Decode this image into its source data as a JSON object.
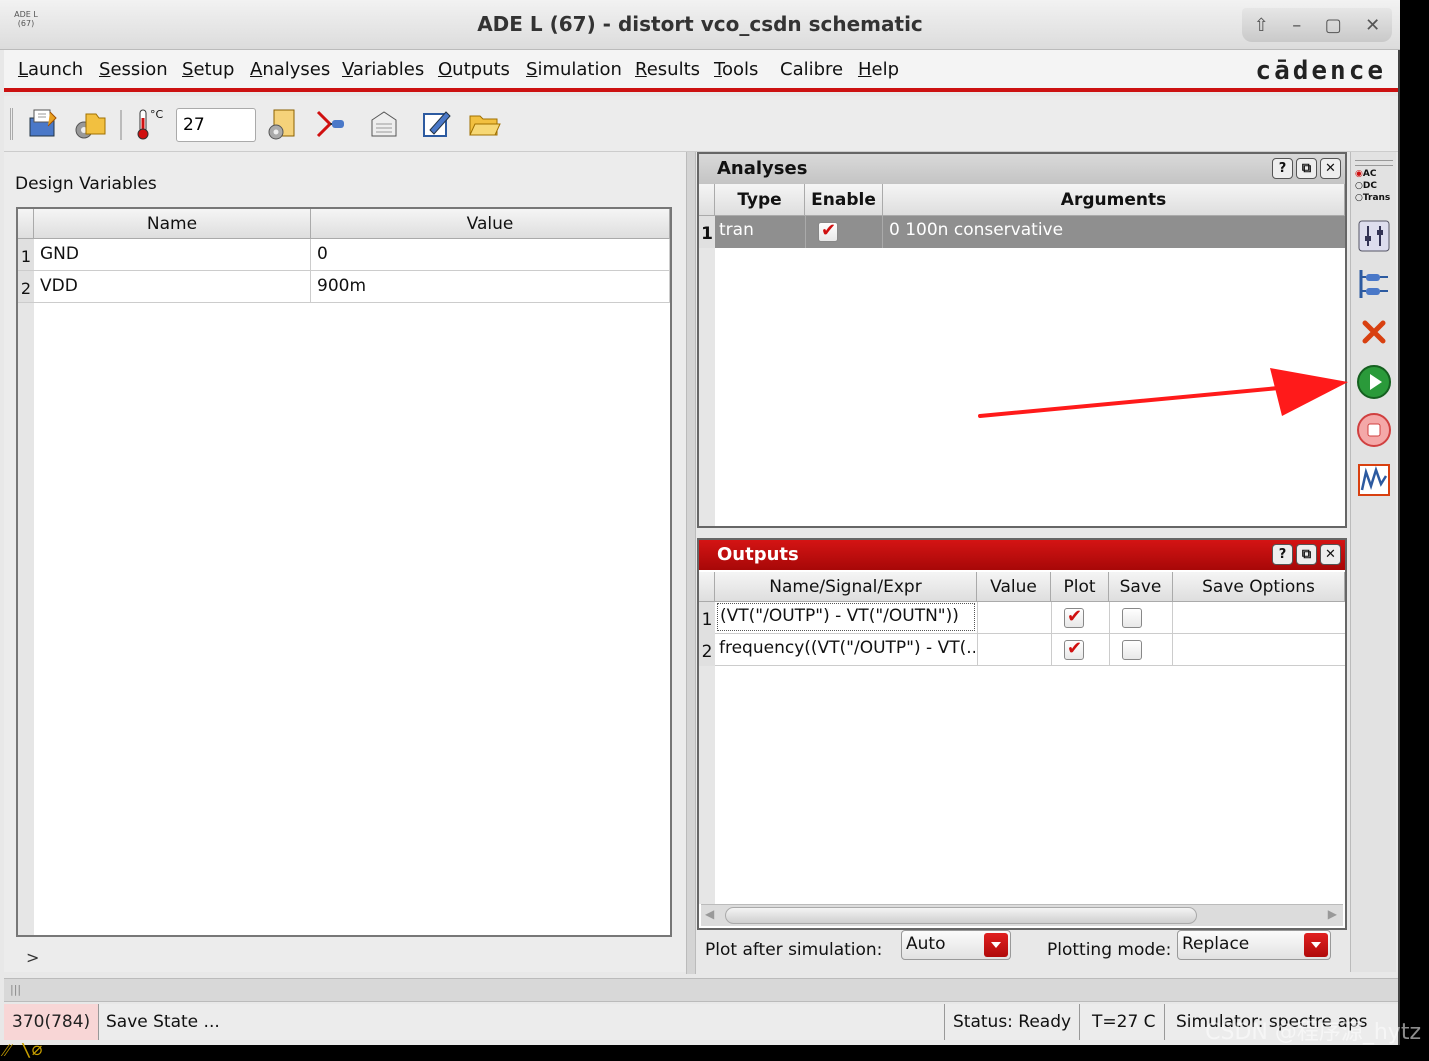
{
  "window": {
    "title": "ADE L (67) - distort vco_csdn schematic",
    "app_icon_text": "ADE L (67)"
  },
  "menu": [
    {
      "label": "Launch",
      "u": "L"
    },
    {
      "label": "Session",
      "u": "S"
    },
    {
      "label": "Setup",
      "u": "S"
    },
    {
      "label": "Analyses",
      "u": "A"
    },
    {
      "label": "Variables",
      "u": "V"
    },
    {
      "label": "Outputs",
      "u": "O"
    },
    {
      "label": "Simulation",
      "u": "S"
    },
    {
      "label": "Results",
      "u": "R"
    },
    {
      "label": "Tools",
      "u": "T"
    },
    {
      "label": "Calibre",
      "u": ""
    },
    {
      "label": "Help",
      "u": "H"
    }
  ],
  "brand": "cādence",
  "toolbar": {
    "temperature_value": "27",
    "temperature_unit": "°C",
    "icons": [
      "save-state-icon",
      "load-state-icon",
      "thermometer-icon",
      "setup-model-icon",
      "select-on-schematic-icon",
      "netlist-icon",
      "edit-icon",
      "open-folder-icon"
    ]
  },
  "design_variables": {
    "title": "Design Variables",
    "columns": [
      "Name",
      "Value"
    ],
    "rows": [
      {
        "num": "1",
        "name": "GND",
        "value": "0"
      },
      {
        "num": "2",
        "name": "VDD",
        "value": "900m"
      }
    ],
    "prompt": ">"
  },
  "analyses": {
    "title": "Analyses",
    "columns": [
      "Type",
      "Enable",
      "Arguments"
    ],
    "rows": [
      {
        "num": "1",
        "type": "tran",
        "enabled": true,
        "arguments": "0 100n conservative"
      }
    ]
  },
  "outputs": {
    "title": "Outputs",
    "columns": [
      "Name/Signal/Expr",
      "Value",
      "Plot",
      "Save",
      "Save Options"
    ],
    "rows": [
      {
        "num": "1",
        "expr": "(VT(\"/OUTP\") - VT(\"/OUTN\"))",
        "value": "",
        "plot": true,
        "save": false,
        "save_options": ""
      },
      {
        "num": "2",
        "expr": "frequency((VT(\"/OUTP\") - VT(...",
        "value": "",
        "plot": true,
        "save": false,
        "save_options": ""
      }
    ]
  },
  "plot_after_simulation": {
    "label": "Plot after simulation:",
    "value": "Auto"
  },
  "plotting_mode": {
    "label": "Plotting mode:",
    "value": "Replace"
  },
  "right_toolbar": {
    "radio_labels": [
      "AC",
      "DC",
      "Trans"
    ],
    "icons": [
      "choose-analyses-icon",
      "edit-variables-icon",
      "delete-icon",
      "run-simulation-icon",
      "stop-simulation-icon",
      "plot-outputs-icon"
    ]
  },
  "status": {
    "command_count": "370(784)",
    "message": "Save State ...",
    "state": "Status: Ready",
    "temperature": "T=27 C",
    "simulator": "Simulator: spectre aps"
  },
  "watermark": "CSDN @程序源_hytz",
  "colors": {
    "accent": "#cc1111",
    "run_green": "#2a9a3a"
  }
}
